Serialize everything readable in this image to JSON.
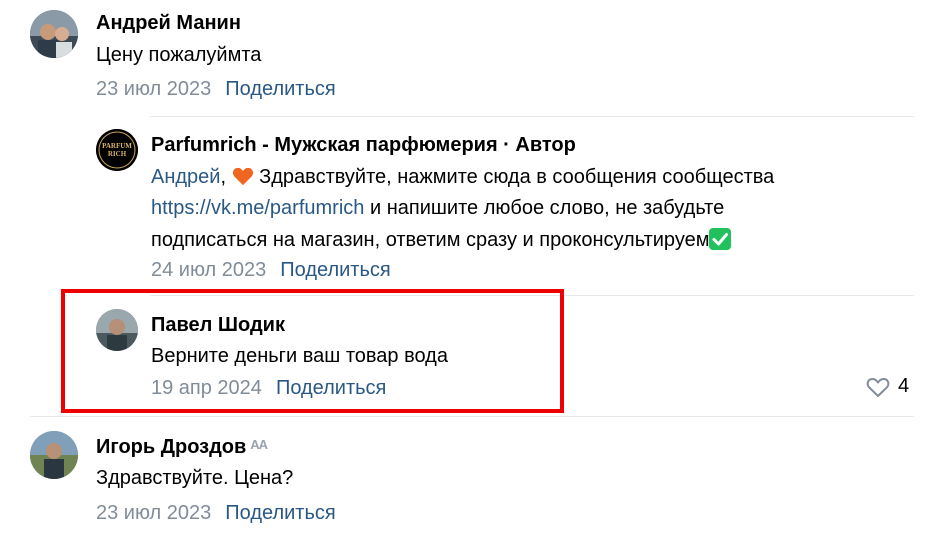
{
  "comments": [
    {
      "author": "Андрей Манин",
      "text": "Цену пожалуймта",
      "date": "23 июл 2023",
      "share_label": "Поделиться"
    },
    {
      "author": "Parfumrich - Мужская парфюмерия · Автор",
      "avatar_logo": "PARFUM RICH",
      "reply_to": "Андрей",
      "line1_text": " Здравствуйте, нажмите сюда в сообщения сообщества",
      "link": "https://vk.me/parfumrich",
      "line2_text": " и напишите любое слово, не забудьте",
      "line3_text": "подписаться на магазин, ответим сразу и проконсультируем",
      "date": "24 июл 2023",
      "share_label": "Поделиться"
    },
    {
      "author": "Павел Шодик",
      "text": "Верните деньги ваш товар вода",
      "date": "19 апр 2024",
      "share_label": "Поделиться",
      "likes": "4"
    },
    {
      "author": "Игорь Дроздов",
      "badge": "AA",
      "text": "Здравствуйте. Цена?",
      "date": "23 июл 2023",
      "share_label": "Поделиться"
    }
  ],
  "colors": {
    "link": "#2a5885",
    "meta": "#818c99",
    "highlight": "#ee0000",
    "divider": "#e7e8ec"
  },
  "icons": [
    "heart-emoji-icon",
    "check-mark-emoji-icon",
    "like-heart-icon"
  ]
}
